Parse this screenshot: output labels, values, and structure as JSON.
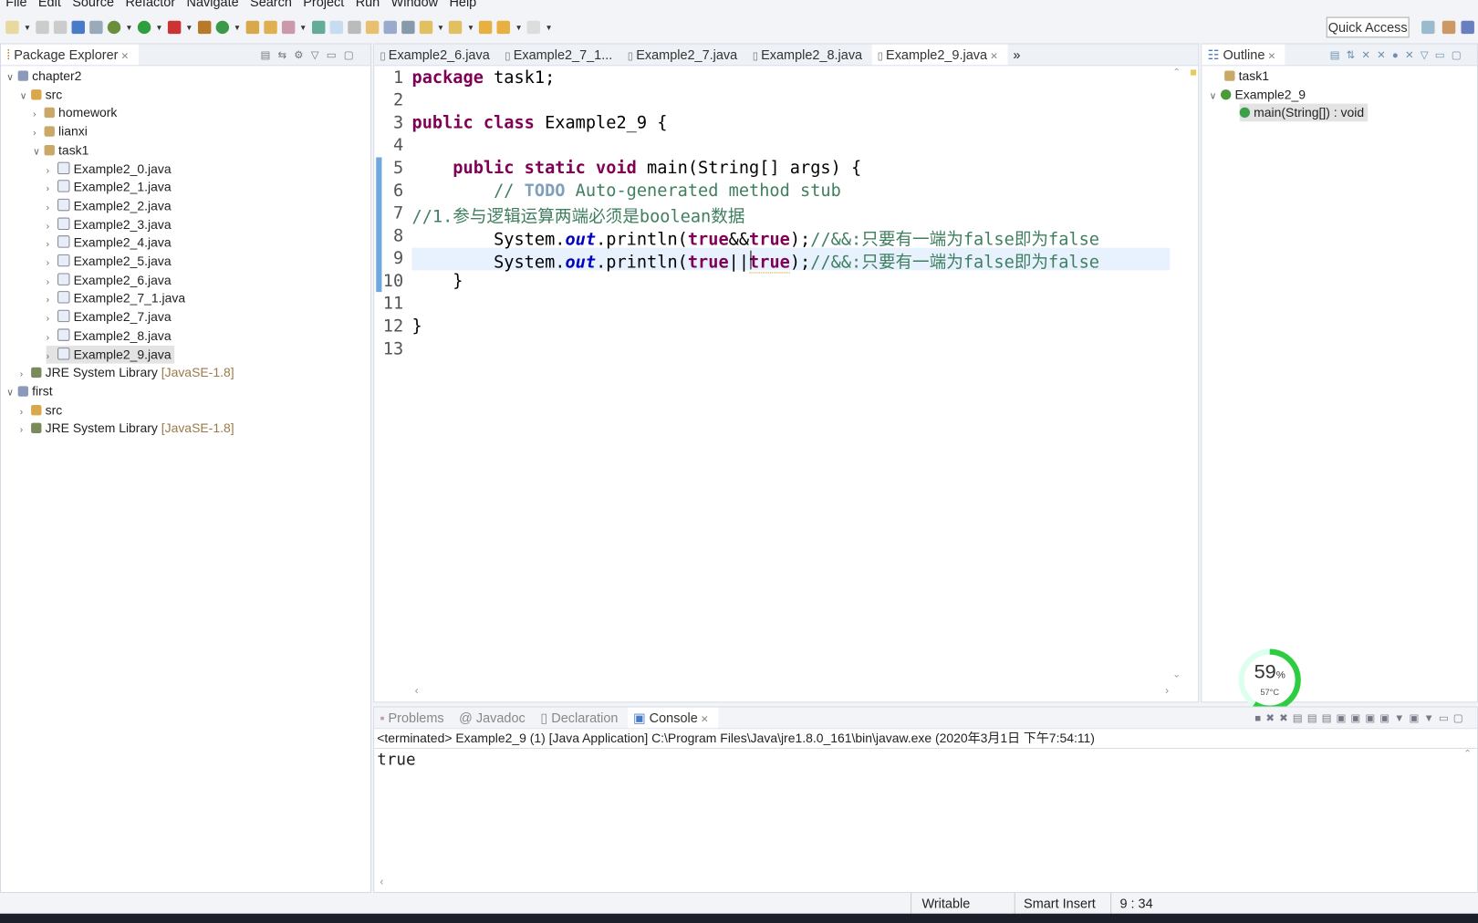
{
  "menu": [
    "File",
    "Edit",
    "Source",
    "Refactor",
    "Navigate",
    "Search",
    "Project",
    "Run",
    "Window",
    "Help"
  ],
  "toolbar": {
    "quick_access": "Quick Access"
  },
  "package_explorer": {
    "title": "Package Explorer",
    "tree": [
      {
        "label": "chapter2",
        "depth": 0,
        "expanded": true,
        "icon": "project-icon"
      },
      {
        "label": "src",
        "depth": 1,
        "expanded": true,
        "icon": "source-folder-icon"
      },
      {
        "label": "homework",
        "depth": 2,
        "expanded": false,
        "icon": "package-icon"
      },
      {
        "label": "lianxi",
        "depth": 2,
        "expanded": false,
        "icon": "package-icon"
      },
      {
        "label": "task1",
        "depth": 2,
        "expanded": true,
        "icon": "package-icon"
      },
      {
        "label": "Example2_0.java",
        "depth": 3,
        "icon": "java-file-icon"
      },
      {
        "label": "Example2_1.java",
        "depth": 3,
        "icon": "java-file-icon"
      },
      {
        "label": "Example2_2.java",
        "depth": 3,
        "icon": "java-file-icon"
      },
      {
        "label": "Example2_3.java",
        "depth": 3,
        "icon": "java-file-icon"
      },
      {
        "label": "Example2_4.java",
        "depth": 3,
        "icon": "java-file-icon"
      },
      {
        "label": "Example2_5.java",
        "depth": 3,
        "icon": "java-file-icon"
      },
      {
        "label": "Example2_6.java",
        "depth": 3,
        "icon": "java-file-icon"
      },
      {
        "label": "Example2_7_1.java",
        "depth": 3,
        "icon": "java-file-icon"
      },
      {
        "label": "Example2_7.java",
        "depth": 3,
        "icon": "java-file-icon"
      },
      {
        "label": "Example2_8.java",
        "depth": 3,
        "icon": "java-file-icon"
      },
      {
        "label": "Example2_9.java",
        "depth": 3,
        "icon": "java-file-icon",
        "selected": true
      },
      {
        "label": "JRE System Library",
        "suffix": "[JavaSE-1.8]",
        "depth": 1,
        "expanded": false,
        "icon": "library-icon"
      },
      {
        "label": "first",
        "depth": 0,
        "expanded": true,
        "icon": "project-icon"
      },
      {
        "label": "src",
        "depth": 1,
        "expanded": false,
        "icon": "source-folder-icon"
      },
      {
        "label": "JRE System Library",
        "suffix": "[JavaSE-1.8]",
        "depth": 1,
        "expanded": false,
        "icon": "library-icon"
      }
    ]
  },
  "editor": {
    "tabs": [
      "Example2_6.java",
      "Example2_7_1...",
      "Example2_7.java",
      "Example2_8.java",
      "Example2_9.java"
    ],
    "active_tab": 4,
    "overflow": "»",
    "line_numbers": [
      "1",
      "2",
      "3",
      "4",
      "5",
      "6",
      "7",
      "8",
      "9",
      "10",
      "11",
      "12",
      "13"
    ],
    "code": {
      "l1a": "package",
      "l1b": " task1;",
      "l3a": "public class",
      "l3b": " Example2_9 {",
      "l5a": "    public static void",
      "l5b": " main(String[] args) {",
      "l6a": "        // ",
      "l6b": "TODO",
      "l6c": " Auto-generated method stub",
      "l7": "//1.参与逻辑运算两端必须是boolean数据",
      "l8a": "        System.",
      "l8b": "out",
      "l8c": ".println(",
      "l8d": "true",
      "l8e": "&&",
      "l8f": "true",
      "l8g": ");",
      "l8h": "//&&:只要有一端为false即为false",
      "l9a": "        System.",
      "l9b": "out",
      "l9c": ".println(",
      "l9d": "true",
      "l9e": "||",
      "l9f": "true",
      "l9g": ");",
      "l9h": "//&&:只要有一端为false即为false",
      "l10": "    }",
      "l12": "}"
    }
  },
  "outline": {
    "title": "Outline",
    "items": [
      "task1",
      "Example2_9",
      "main(String[]) : void"
    ]
  },
  "bottom": {
    "tabs": [
      "Problems",
      "Javadoc",
      "Declaration",
      "Console"
    ],
    "active_tab": 3,
    "terminated": "<terminated> Example2_9 (1) [Java Application] C:\\Program Files\\Java\\jre1.8.0_161\\bin\\javaw.exe (2020年3月1日 下午7:54:11)",
    "output": "true"
  },
  "status": {
    "writable": "Writable",
    "insert": "Smart Insert",
    "position": "9 : 34"
  },
  "gauge": {
    "percent": "59",
    "unit": "%",
    "temp": "57°C",
    "value": 59,
    "color": "#2ecc40"
  }
}
